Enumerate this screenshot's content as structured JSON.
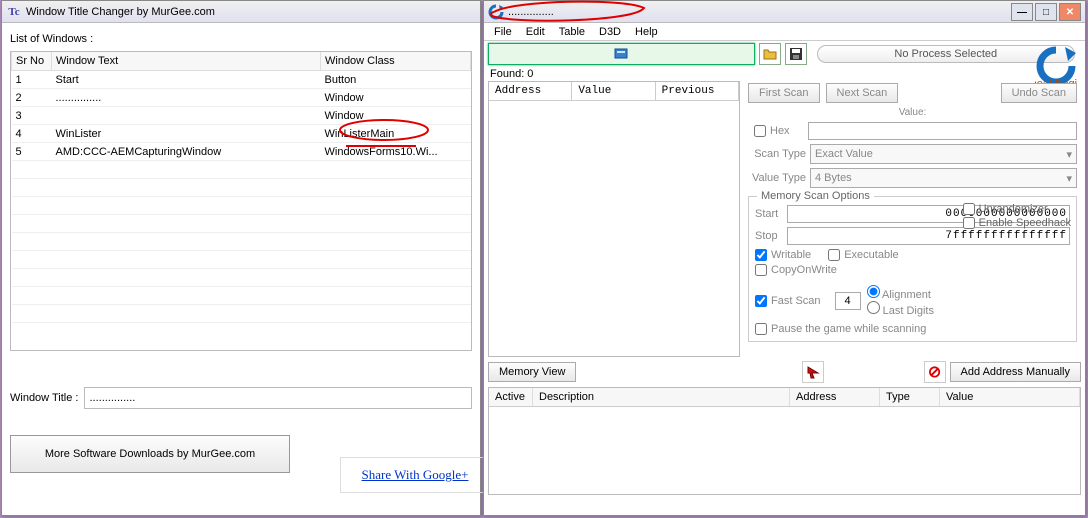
{
  "left": {
    "title": "Window Title Changer by MurGee.com",
    "list_label": "List of Windows :",
    "columns": {
      "sr": "Sr No",
      "text": "Window Text",
      "cls": "Window Class"
    },
    "rows": [
      {
        "sr": "1",
        "text": "Start",
        "cls": "Button"
      },
      {
        "sr": "2",
        "text": "...............",
        "cls": "Window"
      },
      {
        "sr": "3",
        "text": "",
        "cls": "Window"
      },
      {
        "sr": "4",
        "text": "WinLister",
        "cls": "WinListerMain"
      },
      {
        "sr": "5",
        "text": "AMD:CCC-AEMCapturingWindow",
        "cls": "WindowsForms10.Wi..."
      }
    ],
    "window_title_label": "Window Title :",
    "window_title_value": "...............",
    "more_btn": "More Software Downloads by MurGee.com",
    "share_link": "Share With Google+"
  },
  "right": {
    "title": "...............",
    "menu": [
      "File",
      "Edit",
      "Table",
      "D3D",
      "Help"
    ],
    "process_label": "No Process Selected",
    "found_label": "Found: 0",
    "scan_cols": {
      "addr": "Address",
      "val": "Value",
      "prev": "Previous"
    },
    "first_scan": "First Scan",
    "next_scan": "Next Scan",
    "undo_scan": "Undo Scan",
    "value_lbl": "Value:",
    "hex_label": "Hex",
    "scantype_lbl": "Scan Type",
    "scantype_val": "Exact Value",
    "valuetype_lbl": "Value Type",
    "valuetype_val": "4 Bytes",
    "ms_title": "Memory Scan Options",
    "start_lbl": "Start",
    "start_val": "0000000000000000",
    "stop_lbl": "Stop",
    "stop_val": "7fffffffffffffff",
    "writable": "Writable",
    "executable": "Executable",
    "copyonwrite": "CopyOnWrite",
    "fastscan": "Fast Scan",
    "fastscan_val": "4",
    "alignment": "Alignment",
    "lastdigits": "Last Digits",
    "pause_lbl": "Pause the game while scanning",
    "unrand": "Unrandomizer",
    "speedhack": "Enable Speedhack",
    "memview": "Memory View",
    "addmanual": "Add Address Manually",
    "settings": "Settings",
    "bottom_cols": {
      "active": "Active",
      "desc": "Description",
      "addr": "Address",
      "type": "Type",
      "val": "Value"
    }
  }
}
